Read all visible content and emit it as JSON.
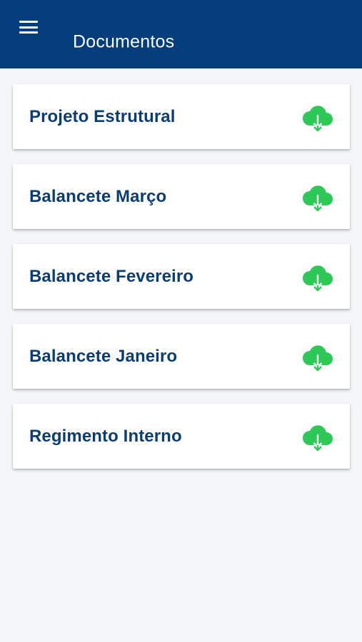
{
  "header": {
    "title": "Documentos",
    "menu_icon": "hamburger-menu-icon"
  },
  "documents": [
    {
      "title": "Projeto Estrutural",
      "icon": "cloud-download-icon"
    },
    {
      "title": "Balancete Março",
      "icon": "cloud-download-icon"
    },
    {
      "title": "Balancete Fevereiro",
      "icon": "cloud-download-icon"
    },
    {
      "title": "Balancete Janeiro",
      "icon": "cloud-download-icon"
    },
    {
      "title": "Regimento Interno",
      "icon": "cloud-download-icon"
    }
  ],
  "colors": {
    "app_bar": "#033d7b",
    "background": "#f4f6f9",
    "title_text": "#0b3d73",
    "download_icon": "#2cc956"
  }
}
